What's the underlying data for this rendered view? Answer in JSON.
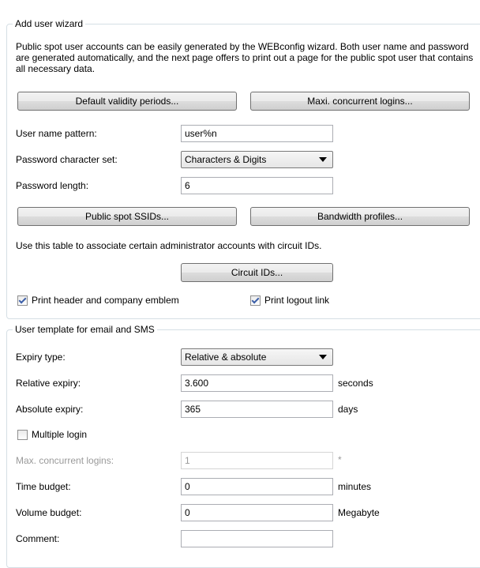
{
  "wizard": {
    "legend": "Add user wizard",
    "description": "Public spot user accounts can be easily generated by the WEBconfig wizard. Both user name and password are generated automatically, and the next page offers to print out a page for the public spot user that contains all necessary data.",
    "btn_default_validity": "Default validity periods...",
    "btn_max_concurrent": "Maxi. concurrent logins...",
    "username_pattern_label": "User name pattern:",
    "username_pattern_value": "user%n",
    "password_charset_label": "Password character set:",
    "password_charset_value": "Characters & Digits",
    "password_length_label": "Password length:",
    "password_length_value": "6",
    "btn_ssids": "Public spot SSIDs...",
    "btn_bandwidth": "Bandwidth profiles...",
    "circuit_text": "Use this table to associate certain administrator accounts with circuit IDs.",
    "btn_circuit_ids": "Circuit IDs...",
    "print_header_label": "Print header and company emblem",
    "print_header_checked": true,
    "print_logout_label": "Print logout link",
    "print_logout_checked": true
  },
  "template": {
    "legend": "User template for email and SMS",
    "expiry_type_label": "Expiry type:",
    "expiry_type_value": "Relative & absolute",
    "relative_expiry_label": "Relative expiry:",
    "relative_expiry_value": "3.600",
    "relative_expiry_unit": "seconds",
    "absolute_expiry_label": "Absolute expiry:",
    "absolute_expiry_value": "365",
    "absolute_expiry_unit": "days",
    "multiple_login_label": "Multiple login",
    "multiple_login_checked": false,
    "max_concurrent_label": "Max. concurrent logins:",
    "max_concurrent_value": "1",
    "max_concurrent_unit": "*",
    "time_budget_label": "Time budget:",
    "time_budget_value": "0",
    "time_budget_unit": "minutes",
    "volume_budget_label": "Volume budget:",
    "volume_budget_value": "0",
    "volume_budget_unit": "Megabyte",
    "comment_label": "Comment:",
    "comment_value": ""
  }
}
